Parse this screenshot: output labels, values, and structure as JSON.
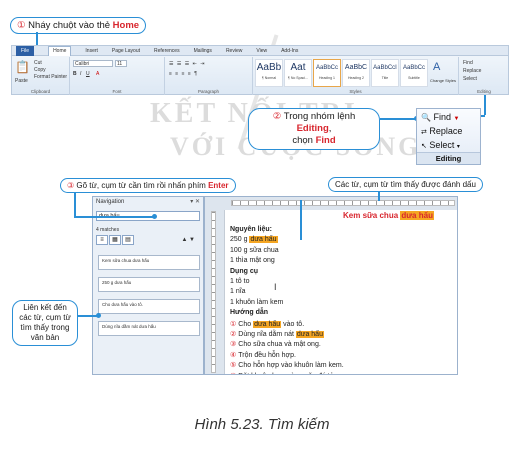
{
  "callouts": {
    "c1": {
      "num": "①",
      "text": "Nháy chuột vào thẻ ",
      "em": "Home"
    },
    "c2": {
      "num": "②",
      "text1": "Trong nhóm lệnh ",
      "em1": "Editing",
      "text2": ",",
      "text3": "chọn ",
      "em2": "Find"
    },
    "c3": {
      "num": "③",
      "text": "Gõ từ, cụm từ cần tìm rồi nhấn phím ",
      "em": "Enter"
    },
    "c4": {
      "text": "Các từ, cụm từ tìm thấy được đánh dấu"
    },
    "c5": {
      "text": "Liên kết đến các từ, cụm từ tìm thấy trong văn bản"
    }
  },
  "watermark": {
    "line1": "KẾT NỐI TRI",
    "line2": "VỚI CUỘC SỐNG"
  },
  "ribbon": {
    "tabs": [
      "File",
      "Home",
      "Insert",
      "Page Layout",
      "References",
      "Mailings",
      "Review",
      "View",
      "Add-Ins"
    ],
    "active_tab": "Home",
    "groups": [
      "Clipboard",
      "Font",
      "Paragraph",
      "Styles",
      "Editing"
    ],
    "clipboard_items": [
      "Cut",
      "Copy",
      "Format Painter"
    ],
    "paste_label": "Paste",
    "font_name": "Calibri",
    "font_size": "11",
    "styles": [
      {
        "sample": "AaBb",
        "name": "¶ Normal"
      },
      {
        "sample": "Aat",
        "name": "¶ No Spaci..."
      },
      {
        "sample": "AaBbCc",
        "name": "Heading 1"
      },
      {
        "sample": "AaBbC",
        "name": "Heading 2"
      },
      {
        "sample": "AaBbCcI",
        "name": "Title"
      },
      {
        "sample": "AaBbCc",
        "name": "Subtitle"
      },
      {
        "sample": "AaBbCcI",
        "name": "Subtle Em..."
      },
      {
        "sample": "AaBbCc",
        "name": "Emphasis"
      }
    ],
    "change_styles": "Change Styles",
    "editing_mini": [
      "Find",
      "Replace",
      "Select"
    ]
  },
  "editing_panel": {
    "find": "Find",
    "replace": "Replace",
    "select": "Select",
    "label": "Editing"
  },
  "navigation": {
    "title": "Navigation",
    "search_value": "dưa hấu",
    "match_count": "4 matches",
    "results": [
      "Kem sữa chua dưa hấu",
      "250 g dưa hấu",
      "Cho dưa hấu vào tô.",
      "Dùng nĩa dằm nát dưa hấu"
    ]
  },
  "document": {
    "title_pre": "Kem sữa chua ",
    "title_hl": "dưa hấu",
    "lines": [
      {
        "pre": "Nguyên liệu:",
        "hl": "",
        "post": "",
        "bold": true,
        "num": ""
      },
      {
        "pre": "250 g ",
        "hl": "dưa hấu",
        "post": "",
        "bold": false,
        "num": ""
      },
      {
        "pre": "100 g sữa chua",
        "hl": "",
        "post": "",
        "bold": false,
        "num": ""
      },
      {
        "pre": "1 thìa mật ong",
        "hl": "",
        "post": "",
        "bold": false,
        "num": ""
      },
      {
        "pre": "Dụng cụ",
        "hl": "",
        "post": "",
        "bold": true,
        "num": ""
      },
      {
        "pre": "1 tô to",
        "hl": "",
        "post": "",
        "bold": false,
        "num": ""
      },
      {
        "pre": "1 nĩa",
        "hl": "",
        "post": "",
        "bold": false,
        "num": ""
      },
      {
        "pre": "1 khuôn làm kem",
        "hl": "",
        "post": "",
        "bold": false,
        "num": ""
      },
      {
        "pre": "Hướng dẫn",
        "hl": "",
        "post": "",
        "bold": true,
        "num": ""
      },
      {
        "pre": "Cho ",
        "hl": "dưa hấu",
        "post": " vào tô.",
        "bold": false,
        "num": "①"
      },
      {
        "pre": "Dùng nĩa dằm nát ",
        "hl": "dưa hấu",
        "post": "",
        "bold": false,
        "num": "②"
      },
      {
        "pre": "Cho sữa chua và mật ong.",
        "hl": "",
        "post": "",
        "bold": false,
        "num": "③"
      },
      {
        "pre": "Trộn đều hỗn hợp.",
        "hl": "",
        "post": "",
        "bold": false,
        "num": "④"
      },
      {
        "pre": "Cho hỗn hợp vào khuôn làm kem.",
        "hl": "",
        "post": "",
        "bold": false,
        "num": "⑤"
      },
      {
        "pre": "Đặt khuôn kem vào ngăn đá tủ",
        "hl": "",
        "post": "",
        "bold": false,
        "num": "⑥"
      }
    ]
  },
  "caption": "Hình 5.23. Tìm kiếm",
  "colors": {
    "accent": "#2a8fd6",
    "highlight": "#f5a623",
    "red": "#d8262e"
  }
}
